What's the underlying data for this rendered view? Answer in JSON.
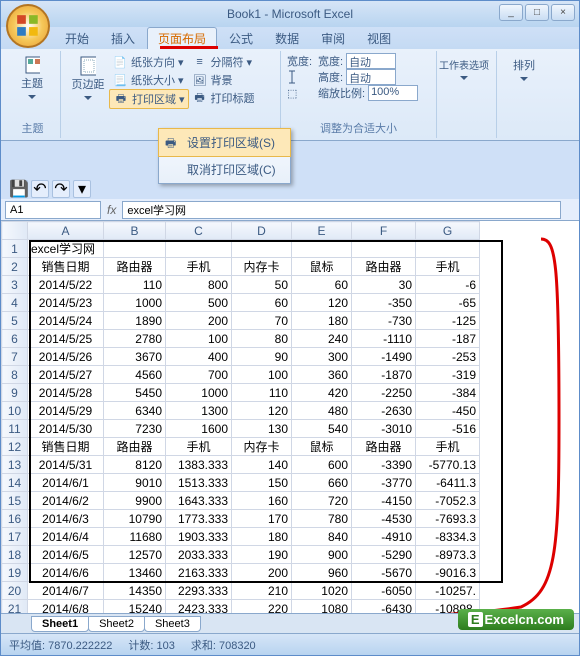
{
  "window": {
    "title": "Book1 - Microsoft Excel"
  },
  "tabs": [
    "开始",
    "插入",
    "页面布局",
    "公式",
    "数据",
    "审阅",
    "视图"
  ],
  "active_tab": 2,
  "ribbon": {
    "themes": {
      "label": "主题",
      "btn": "主题"
    },
    "page_setup": {
      "margin": "页边距",
      "orientation": "纸张方向",
      "size": "纸张大小",
      "print_area": "打印区域",
      "breaks": "分隔符",
      "background": "背景",
      "print_titles": "打印标题"
    },
    "scale": {
      "label": "调整为合适大小",
      "width_lbl": "宽度:",
      "height_lbl": "高度:",
      "scale_lbl": "缩放比例:",
      "auto": "自动",
      "scale_val": "100%"
    },
    "sheet_options": "工作表选项",
    "arrange": "排列"
  },
  "dropdown": {
    "set_print_area": "设置打印区域(S)",
    "clear_print_area": "取消打印区域(C)"
  },
  "namebox": "A1",
  "formula": "excel学习网",
  "cols": [
    "A",
    "B",
    "C",
    "D",
    "E",
    "F",
    "G"
  ],
  "rows": [
    {
      "n": 1,
      "cells": [
        "excel学习网",
        "",
        "",
        "",
        "",
        "",
        ""
      ]
    },
    {
      "n": 2,
      "cells": [
        "销售日期",
        "路由器",
        "手机",
        "内存卡",
        "鼠标",
        "路由器",
        "手机"
      ]
    },
    {
      "n": 3,
      "cells": [
        "2014/5/22",
        "110",
        "800",
        "50",
        "60",
        "30",
        "-6"
      ]
    },
    {
      "n": 4,
      "cells": [
        "2014/5/23",
        "1000",
        "500",
        "60",
        "120",
        "-350",
        "-65"
      ]
    },
    {
      "n": 5,
      "cells": [
        "2014/5/24",
        "1890",
        "200",
        "70",
        "180",
        "-730",
        "-125"
      ]
    },
    {
      "n": 6,
      "cells": [
        "2014/5/25",
        "2780",
        "100",
        "80",
        "240",
        "-1110",
        "-187"
      ]
    },
    {
      "n": 7,
      "cells": [
        "2014/5/26",
        "3670",
        "400",
        "90",
        "300",
        "-1490",
        "-253"
      ]
    },
    {
      "n": 8,
      "cells": [
        "2014/5/27",
        "4560",
        "700",
        "100",
        "360",
        "-1870",
        "-319"
      ]
    },
    {
      "n": 9,
      "cells": [
        "2014/5/28",
        "5450",
        "1000",
        "110",
        "420",
        "-2250",
        "-384"
      ]
    },
    {
      "n": 10,
      "cells": [
        "2014/5/29",
        "6340",
        "1300",
        "120",
        "480",
        "-2630",
        "-450"
      ]
    },
    {
      "n": 11,
      "cells": [
        "2014/5/30",
        "7230",
        "1600",
        "130",
        "540",
        "-3010",
        "-516"
      ]
    },
    {
      "n": 12,
      "cells": [
        "销售日期",
        "路由器",
        "手机",
        "内存卡",
        "鼠标",
        "路由器",
        "手机"
      ]
    },
    {
      "n": 13,
      "cells": [
        "2014/5/31",
        "8120",
        "1383.333",
        "140",
        "600",
        "-3390",
        "-5770.13"
      ]
    },
    {
      "n": 14,
      "cells": [
        "2014/6/1",
        "9010",
        "1513.333",
        "150",
        "660",
        "-3770",
        "-6411.3"
      ]
    },
    {
      "n": 15,
      "cells": [
        "2014/6/2",
        "9900",
        "1643.333",
        "160",
        "720",
        "-4150",
        "-7052.3"
      ]
    },
    {
      "n": 16,
      "cells": [
        "2014/6/3",
        "10790",
        "1773.333",
        "170",
        "780",
        "-4530",
        "-7693.3"
      ]
    },
    {
      "n": 17,
      "cells": [
        "2014/6/4",
        "11680",
        "1903.333",
        "180",
        "840",
        "-4910",
        "-8334.3"
      ]
    },
    {
      "n": 18,
      "cells": [
        "2014/6/5",
        "12570",
        "2033.333",
        "190",
        "900",
        "-5290",
        "-8973.3"
      ]
    },
    {
      "n": 19,
      "cells": [
        "2014/6/6",
        "13460",
        "2163.333",
        "200",
        "960",
        "-5670",
        "-9016.3"
      ]
    },
    {
      "n": 20,
      "cells": [
        "2014/6/7",
        "14350",
        "2293.333",
        "210",
        "1020",
        "-6050",
        "-10257."
      ]
    },
    {
      "n": 21,
      "cells": [
        "2014/6/8",
        "15240",
        "2423.333",
        "220",
        "1080",
        "-6430",
        "-10898."
      ]
    }
  ],
  "sheets": [
    "Sheet1",
    "Sheet2",
    "Sheet3"
  ],
  "status": {
    "avg_lbl": "平均值:",
    "avg": "7870.222222",
    "count_lbl": "计数:",
    "count": "103",
    "sum_lbl": "求和:",
    "sum": "708320"
  },
  "logo": "Excelcn.com"
}
